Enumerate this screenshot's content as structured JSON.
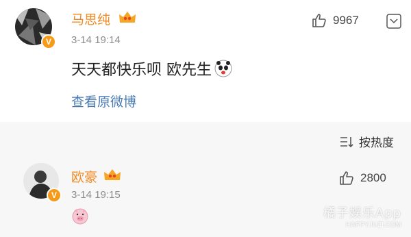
{
  "post": {
    "username": "马思纯",
    "time": "3-14 19:14",
    "content": "天天都快乐呗 欧先生",
    "likes": "9967",
    "view_original": "查看原微博"
  },
  "sort": {
    "label": "按热度"
  },
  "comment": {
    "username": "欧豪",
    "time": "3-14 19:15",
    "likes": "2800"
  },
  "watermark": {
    "title": "橘子娱乐App",
    "url": "HAPPYJUZI.COM"
  },
  "badges": {
    "verified": "V"
  },
  "icons": [
    "verified-badge-icon",
    "vip-crown-icon",
    "thumbs-up-icon",
    "more-square-icon",
    "panda-emoji-icon",
    "sort-icon",
    "pig-emoji-icon"
  ],
  "colors": {
    "username": "#f08a24",
    "link": "#4a7ab6",
    "time": "#8c8c8c",
    "verified": "#f79a18",
    "section_bg": "#f7f7f7"
  }
}
